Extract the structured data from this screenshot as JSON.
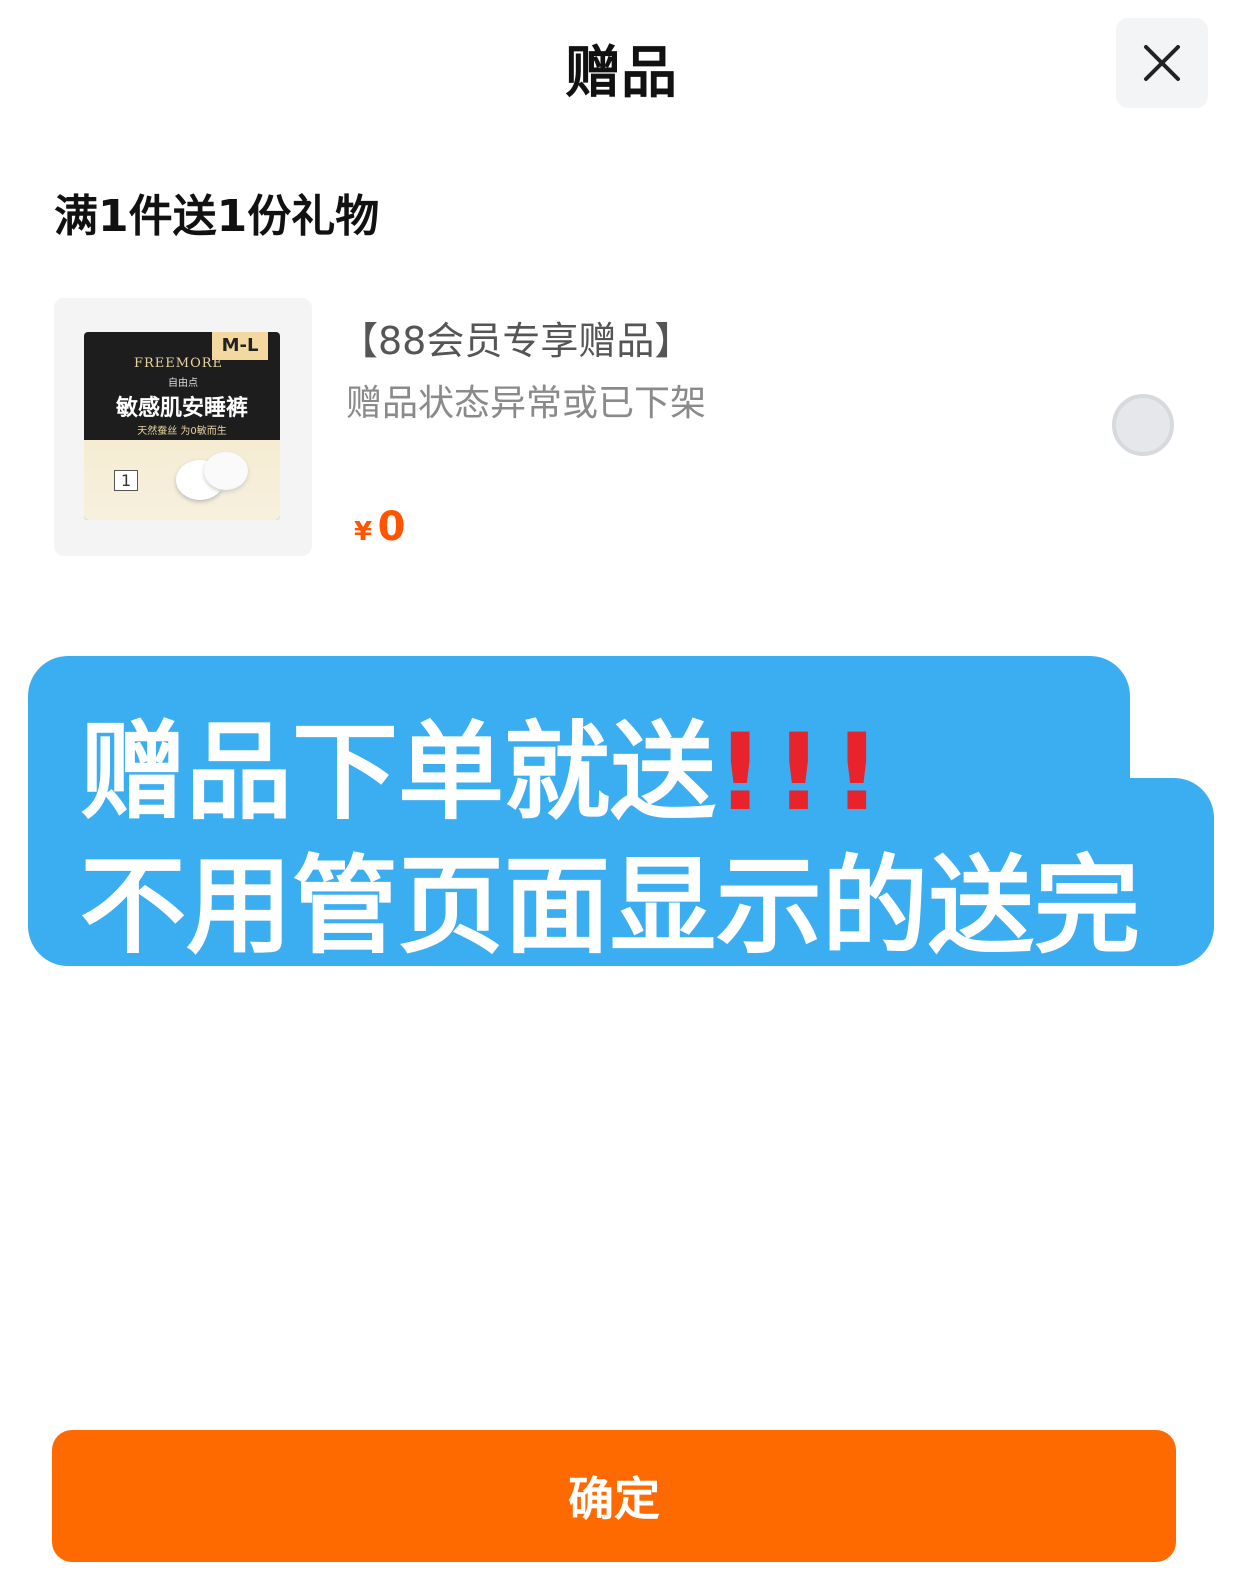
{
  "header": {
    "title": "赠品",
    "close_icon": "close-icon"
  },
  "section": {
    "title": "满1件送1份礼物"
  },
  "gift": {
    "name": "【88会员专享赠品】",
    "status": "赠品状态异常或已下架",
    "price_symbol": "¥",
    "price": "0",
    "selected": false,
    "image": {
      "brand": "FREEMORE",
      "brand_cn": "自由点",
      "size": "M-L",
      "product_name": "敏感肌安睡裤",
      "tagline": "天然蚕丝 为0敏而生",
      "count": "1"
    }
  },
  "overlay_note": {
    "line1": "赠品下单就送",
    "line1_marks": "!!!",
    "line2": "不用管页面显示的送完",
    "accent_color": "#3aaef1"
  },
  "footer": {
    "confirm_label": "确定",
    "accent_color": "#ff6a00"
  }
}
